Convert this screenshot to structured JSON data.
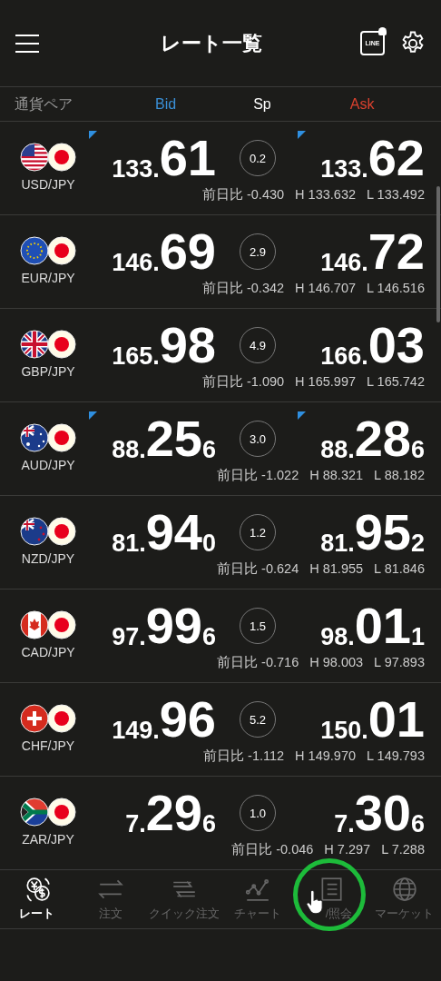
{
  "header": {
    "title": "レート一覧",
    "line_badge": "LINE"
  },
  "columns": {
    "pair": "通貨ペア",
    "bid": "Bid",
    "spread": "Sp",
    "ask": "Ask"
  },
  "rows": [
    {
      "pair": "USD/JPY",
      "kind": "usd",
      "bid": {
        "head": "133.",
        "big": "61",
        "tick_down": true
      },
      "spread": "0.2",
      "change": "前日比 -0.430",
      "ask": {
        "head": "133.",
        "big": "62",
        "tick_down": true
      },
      "high": "H 133.632",
      "low": "L 133.492"
    },
    {
      "pair": "EUR/JPY",
      "kind": "eur",
      "bid": {
        "head": "146.",
        "big": "69",
        "tick_down": false
      },
      "spread": "2.9",
      "change": "前日比 -0.342",
      "ask": {
        "head": "146.",
        "big": "72",
        "tick_down": false
      },
      "high": "H 146.707",
      "low": "L 146.516"
    },
    {
      "pair": "GBP/JPY",
      "kind": "gbp",
      "bid": {
        "head": "165.",
        "big": "98",
        "tick_down": false
      },
      "spread": "4.9",
      "change": "前日比 -1.090",
      "ask": {
        "head": "166.",
        "big": "03",
        "tick_down": false
      },
      "high": "H 165.997",
      "low": "L 165.742"
    },
    {
      "pair": "AUD/JPY",
      "kind": "aud",
      "bid": {
        "head": "88.",
        "big": "25",
        "tail": "6",
        "tick_down": true
      },
      "spread": "3.0",
      "change": "前日比 -1.022",
      "ask": {
        "head": "88.",
        "big": "28",
        "tail": "6",
        "tick_down": true
      },
      "high": "H 88.321",
      "low": "L 88.182"
    },
    {
      "pair": "NZD/JPY",
      "kind": "nzd",
      "bid": {
        "head": "81.",
        "big": "94",
        "tail": "0",
        "tick_down": false
      },
      "spread": "1.2",
      "change": "前日比 -0.624",
      "ask": {
        "head": "81.",
        "big": "95",
        "tail": "2",
        "tick_down": false
      },
      "high": "H 81.955",
      "low": "L 81.846"
    },
    {
      "pair": "CAD/JPY",
      "kind": "cad",
      "bid": {
        "head": "97.",
        "big": "99",
        "tail": "6",
        "tick_down": false
      },
      "spread": "1.5",
      "change": "前日比 -0.716",
      "ask": {
        "head": "98.",
        "big": "01",
        "tail": "1",
        "tick_down": false
      },
      "high": "H 98.003",
      "low": "L 97.893"
    },
    {
      "pair": "CHF/JPY",
      "kind": "chf",
      "bid": {
        "head": "149.",
        "big": "96",
        "tick_down": false
      },
      "spread": "5.2",
      "change": "前日比 -1.112",
      "ask": {
        "head": "150.",
        "big": "01",
        "tick_down": false
      },
      "high": "H 149.970",
      "low": "L 149.793"
    },
    {
      "pair": "ZAR/JPY",
      "kind": "zar",
      "bid": {
        "head": "7.",
        "big": "29",
        "tail": "6",
        "tick_down": false
      },
      "spread": "1.0",
      "change": "前日比 -0.046",
      "ask": {
        "head": "7.",
        "big": "30",
        "tail": "6",
        "tick_down": false
      },
      "high": "H 7.297",
      "low": "L 7.288"
    }
  ],
  "nav": [
    {
      "kind": "rate",
      "label": "レート",
      "selected": true
    },
    {
      "kind": "order",
      "label": "注文",
      "selected": false
    },
    {
      "kind": "quick",
      "label": "クイック注文",
      "selected": false
    },
    {
      "kind": "chart",
      "label": "チャート",
      "selected": false
    },
    {
      "kind": "list",
      "label": "/照会",
      "selected": false
    },
    {
      "kind": "globe",
      "label": "マーケット",
      "selected": false
    }
  ]
}
